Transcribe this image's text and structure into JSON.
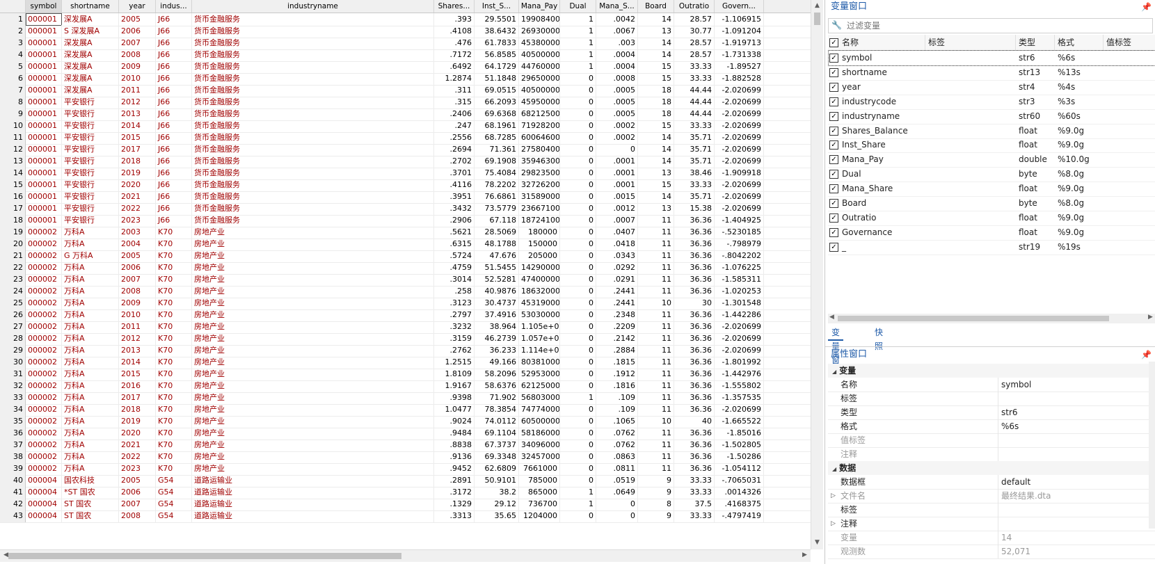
{
  "grid": {
    "columns": [
      "symbol",
      "shortname",
      "year",
      "indus...",
      "industryname",
      "Shares...",
      "Inst_S...",
      "Mana_Pay",
      "Dual",
      "Mana_S...",
      "Board",
      "Outratio",
      "Govern..."
    ],
    "rows": [
      [
        "1",
        "000001",
        "深发展A",
        "2005",
        "J66",
        "货币金融服务",
        ".393",
        "29.5501",
        "19908400",
        "1",
        ".0042",
        "14",
        "28.57",
        "-1.106915"
      ],
      [
        "2",
        "000001",
        "S 深发展A",
        "2006",
        "J66",
        "货币金融服务",
        ".4108",
        "38.6432",
        "26930000",
        "1",
        ".0067",
        "13",
        "30.77",
        "-1.091204"
      ],
      [
        "3",
        "000001",
        "深发展A",
        "2007",
        "J66",
        "货币金融服务",
        ".476",
        "61.7833",
        "45380000",
        "1",
        ".003",
        "14",
        "28.57",
        "-1.919713"
      ],
      [
        "4",
        "000001",
        "深发展A",
        "2008",
        "J66",
        "货币金融服务",
        ".7172",
        "56.8585",
        "40500000",
        "1",
        ".0004",
        "14",
        "28.57",
        "-1.731338"
      ],
      [
        "5",
        "000001",
        "深发展A",
        "2009",
        "J66",
        "货币金融服务",
        ".6492",
        "64.1729",
        "44760000",
        "1",
        ".0004",
        "15",
        "33.33",
        "-1.89527"
      ],
      [
        "6",
        "000001",
        "深发展A",
        "2010",
        "J66",
        "货币金融服务",
        "1.2874",
        "51.1848",
        "29650000",
        "0",
        ".0008",
        "15",
        "33.33",
        "-1.882528"
      ],
      [
        "7",
        "000001",
        "深发展A",
        "2011",
        "J66",
        "货币金融服务",
        ".311",
        "69.0515",
        "40500000",
        "0",
        ".0005",
        "18",
        "44.44",
        "-2.020699"
      ],
      [
        "8",
        "000001",
        "平安银行",
        "2012",
        "J66",
        "货币金融服务",
        ".315",
        "66.2093",
        "45950000",
        "0",
        ".0005",
        "18",
        "44.44",
        "-2.020699"
      ],
      [
        "9",
        "000001",
        "平安银行",
        "2013",
        "J66",
        "货币金融服务",
        ".2406",
        "69.6368",
        "68212500",
        "0",
        ".0005",
        "18",
        "44.44",
        "-2.020699"
      ],
      [
        "10",
        "000001",
        "平安银行",
        "2014",
        "J66",
        "货币金融服务",
        ".247",
        "68.1961",
        "71928200",
        "0",
        ".0002",
        "15",
        "33.33",
        "-2.020699"
      ],
      [
        "11",
        "000001",
        "平安银行",
        "2015",
        "J66",
        "货币金融服务",
        ".2556",
        "68.7285",
        "60064600",
        "0",
        ".0002",
        "14",
        "35.71",
        "-2.020699"
      ],
      [
        "12",
        "000001",
        "平安银行",
        "2017",
        "J66",
        "货币金融服务",
        ".2694",
        "71.361",
        "27580400",
        "0",
        "0",
        "14",
        "35.71",
        "-2.020699"
      ],
      [
        "13",
        "000001",
        "平安银行",
        "2018",
        "J66",
        "货币金融服务",
        ".2702",
        "69.1908",
        "35946300",
        "0",
        ".0001",
        "14",
        "35.71",
        "-2.020699"
      ],
      [
        "14",
        "000001",
        "平安银行",
        "2019",
        "J66",
        "货币金融服务",
        ".3701",
        "75.4084",
        "29823500",
        "0",
        ".0001",
        "13",
        "38.46",
        "-1.909918"
      ],
      [
        "15",
        "000001",
        "平安银行",
        "2020",
        "J66",
        "货币金融服务",
        ".4116",
        "78.2202",
        "32726200",
        "0",
        ".0001",
        "15",
        "33.33",
        "-2.020699"
      ],
      [
        "16",
        "000001",
        "平安银行",
        "2021",
        "J66",
        "货币金融服务",
        ".3951",
        "76.6861",
        "31589000",
        "0",
        ".0015",
        "14",
        "35.71",
        "-2.020699"
      ],
      [
        "17",
        "000001",
        "平安银行",
        "2022",
        "J66",
        "货币金融服务",
        ".3432",
        "73.5779",
        "23667100",
        "0",
        ".0012",
        "13",
        "15.38",
        "-2.020699"
      ],
      [
        "18",
        "000001",
        "平安银行",
        "2023",
        "J66",
        "货币金融服务",
        ".2906",
        "67.118",
        "18724100",
        "0",
        ".0007",
        "11",
        "36.36",
        "-1.404925"
      ],
      [
        "19",
        "000002",
        "万科A",
        "2003",
        "K70",
        "房地产业",
        ".5621",
        "28.5069",
        "180000",
        "0",
        ".0407",
        "11",
        "36.36",
        "-.5230185"
      ],
      [
        "20",
        "000002",
        "万科A",
        "2004",
        "K70",
        "房地产业",
        ".6315",
        "48.1788",
        "150000",
        "0",
        ".0418",
        "11",
        "36.36",
        "-.798979"
      ],
      [
        "21",
        "000002",
        "G 万科A",
        "2005",
        "K70",
        "房地产业",
        ".5724",
        "47.676",
        "205000",
        "0",
        ".0343",
        "11",
        "36.36",
        "-.8042202"
      ],
      [
        "22",
        "000002",
        "万科A",
        "2006",
        "K70",
        "房地产业",
        ".4759",
        "51.5455",
        "14290000",
        "0",
        ".0292",
        "11",
        "36.36",
        "-1.076225"
      ],
      [
        "23",
        "000002",
        "万科A",
        "2007",
        "K70",
        "房地产业",
        ".3014",
        "52.5281",
        "47400000",
        "0",
        ".0291",
        "11",
        "36.36",
        "-1.585311"
      ],
      [
        "24",
        "000002",
        "万科A",
        "2008",
        "K70",
        "房地产业",
        ".258",
        "40.9876",
        "18632000",
        "0",
        ".2441",
        "11",
        "36.36",
        "-1.020253"
      ],
      [
        "25",
        "000002",
        "万科A",
        "2009",
        "K70",
        "房地产业",
        ".3123",
        "30.4737",
        "45319000",
        "0",
        ".2441",
        "10",
        "30",
        "-1.301548"
      ],
      [
        "26",
        "000002",
        "万科A",
        "2010",
        "K70",
        "房地产业",
        ".2797",
        "37.4916",
        "53030000",
        "0",
        ".2348",
        "11",
        "36.36",
        "-1.442286"
      ],
      [
        "27",
        "000002",
        "万科A",
        "2011",
        "K70",
        "房地产业",
        ".3232",
        "38.964",
        "1.105e+08",
        "0",
        ".2209",
        "11",
        "36.36",
        "-2.020699"
      ],
      [
        "28",
        "000002",
        "万科A",
        "2012",
        "K70",
        "房地产业",
        ".3159",
        "46.2739",
        "1.057e+08",
        "0",
        ".2142",
        "11",
        "36.36",
        "-2.020699"
      ],
      [
        "29",
        "000002",
        "万科A",
        "2013",
        "K70",
        "房地产业",
        ".2762",
        "36.233",
        "1.114e+08",
        "0",
        ".2884",
        "11",
        "36.36",
        "-2.020699"
      ],
      [
        "30",
        "000002",
        "万科A",
        "2014",
        "K70",
        "房地产业",
        "1.2515",
        "49.166",
        "80381000",
        "0",
        ".1815",
        "11",
        "36.36",
        "-1.801992"
      ],
      [
        "31",
        "000002",
        "万科A",
        "2015",
        "K70",
        "房地产业",
        "1.8109",
        "58.2096",
        "52953000",
        "0",
        ".1912",
        "11",
        "36.36",
        "-1.442976"
      ],
      [
        "32",
        "000002",
        "万科A",
        "2016",
        "K70",
        "房地产业",
        "1.9167",
        "58.6376",
        "62125000",
        "0",
        ".1816",
        "11",
        "36.36",
        "-1.555802"
      ],
      [
        "33",
        "000002",
        "万科A",
        "2017",
        "K70",
        "房地产业",
        ".9398",
        "71.902",
        "56803000",
        "1",
        ".109",
        "11",
        "36.36",
        "-1.357535"
      ],
      [
        "34",
        "000002",
        "万科A",
        "2018",
        "K70",
        "房地产业",
        "1.0477",
        "78.3854",
        "74774000",
        "0",
        ".109",
        "11",
        "36.36",
        "-2.020699"
      ],
      [
        "35",
        "000002",
        "万科A",
        "2019",
        "K70",
        "房地产业",
        ".9024",
        "74.0112",
        "60500000",
        "0",
        ".1065",
        "10",
        "40",
        "-1.665522"
      ],
      [
        "36",
        "000002",
        "万科A",
        "2020",
        "K70",
        "房地产业",
        ".9484",
        "69.1104",
        "58186000",
        "0",
        ".0762",
        "11",
        "36.36",
        "-1.85016"
      ],
      [
        "37",
        "000002",
        "万科A",
        "2021",
        "K70",
        "房地产业",
        ".8838",
        "67.3737",
        "34096000",
        "0",
        ".0762",
        "11",
        "36.36",
        "-1.502805"
      ],
      [
        "38",
        "000002",
        "万科A",
        "2022",
        "K70",
        "房地产业",
        ".9136",
        "69.3348",
        "32457000",
        "0",
        ".0863",
        "11",
        "36.36",
        "-1.50286"
      ],
      [
        "39",
        "000002",
        "万科A",
        "2023",
        "K70",
        "房地产业",
        ".9452",
        "62.6809",
        "7661000",
        "0",
        ".0811",
        "11",
        "36.36",
        "-1.054112"
      ],
      [
        "40",
        "000004",
        "国农科技",
        "2005",
        "G54",
        "道路运输业",
        ".2891",
        "50.9101",
        "785000",
        "0",
        ".0519",
        "9",
        "33.33",
        "-.7065031"
      ],
      [
        "41",
        "000004",
        "*ST 国农",
        "2006",
        "G54",
        "道路运输业",
        ".3172",
        "38.2",
        "865000",
        "1",
        ".0649",
        "9",
        "33.33",
        ".0014326"
      ],
      [
        "42",
        "000004",
        "ST 国农",
        "2007",
        "G54",
        "道路运输业",
        ".1329",
        "29.12",
        "736700",
        "1",
        "0",
        "8",
        "37.5",
        ".4168375"
      ],
      [
        "43",
        "000004",
        "ST 国农",
        "2008",
        "G54",
        "道路运输业",
        ".3313",
        "35.65",
        "1204000",
        "0",
        "0",
        "9",
        "33.33",
        "-.4797419"
      ]
    ]
  },
  "vars_panel": {
    "title": "变量窗口",
    "filter_placeholder": "过滤变量",
    "headers": [
      "名称",
      "标签",
      "类型",
      "格式",
      "值标签"
    ],
    "vars": [
      [
        "symbol",
        "str6",
        "%6s"
      ],
      [
        "shortname",
        "str13",
        "%13s"
      ],
      [
        "year",
        "str4",
        "%4s"
      ],
      [
        "industrycode",
        "str3",
        "%3s"
      ],
      [
        "industryname",
        "str60",
        "%60s"
      ],
      [
        "Shares_Balance",
        "float",
        "%9.0g"
      ],
      [
        "Inst_Share",
        "float",
        "%9.0g"
      ],
      [
        "Mana_Pay",
        "double",
        "%10.0g"
      ],
      [
        "Dual",
        "byte",
        "%8.0g"
      ],
      [
        "Mana_Share",
        "float",
        "%9.0g"
      ],
      [
        "Board",
        "byte",
        "%8.0g"
      ],
      [
        "Outratio",
        "float",
        "%9.0g"
      ],
      [
        "Governance",
        "float",
        "%9.0g"
      ],
      [
        "_",
        "str19",
        "%19s"
      ]
    ],
    "tabs": [
      "变量窗口",
      "快照"
    ]
  },
  "props_panel": {
    "title": "属性窗口",
    "section_var": "变量",
    "var_rows": [
      {
        "k": "名称",
        "v": "symbol",
        "dim": false
      },
      {
        "k": "标签",
        "v": "",
        "dim": false
      },
      {
        "k": "类型",
        "v": "str6",
        "dim": false
      },
      {
        "k": "格式",
        "v": "%6s",
        "dim": false
      },
      {
        "k": "值标签",
        "v": "",
        "dim": true
      },
      {
        "k": "注释",
        "v": "",
        "dim": true
      }
    ],
    "section_data": "数据",
    "data_rows": [
      {
        "k": "数据框",
        "v": "default",
        "dim": false,
        "exp": false
      },
      {
        "k": "文件名",
        "v": "最终结果.dta",
        "dim": true,
        "exp": true
      },
      {
        "k": "标签",
        "v": "",
        "dim": false,
        "exp": false
      },
      {
        "k": "注释",
        "v": "",
        "dim": false,
        "exp": true
      },
      {
        "k": "变量",
        "v": "14",
        "dim": true,
        "exp": false
      },
      {
        "k": "观测数",
        "v": "52,071",
        "dim": true,
        "exp": false
      }
    ]
  }
}
